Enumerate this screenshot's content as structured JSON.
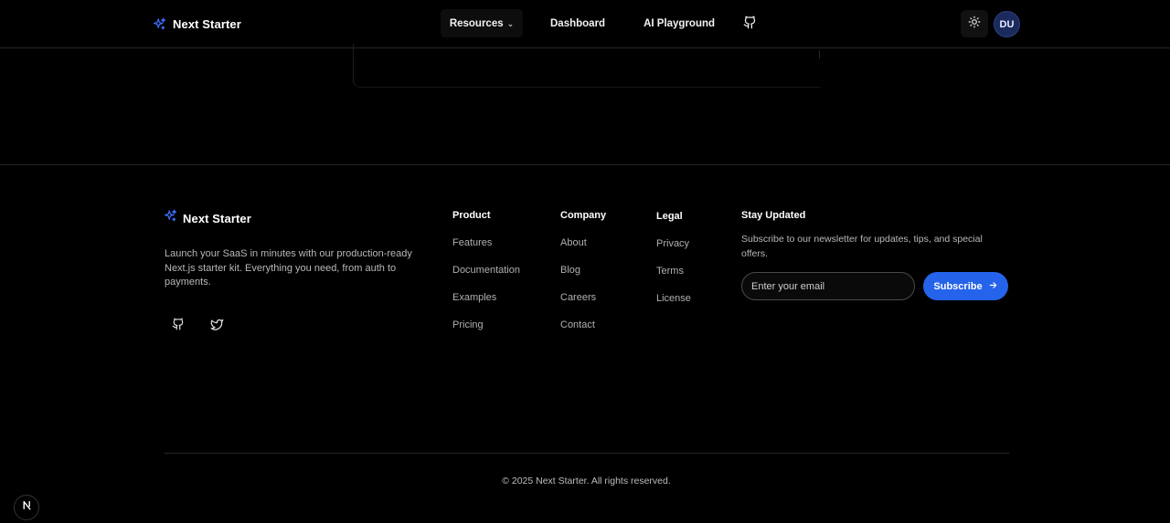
{
  "header": {
    "brand": "Next Starter",
    "nav": {
      "resources": "Resources",
      "dashboard": "Dashboard",
      "ai_playground": "AI Playground"
    },
    "avatar_initials": "DU"
  },
  "footer": {
    "brand": "Next Starter",
    "description": "Launch your SaaS in minutes with our production-ready Next.js starter kit. Everything you need, from auth to payments.",
    "columns": [
      {
        "title": "Product",
        "links": [
          "Features",
          "Documentation",
          "Examples",
          "Pricing"
        ]
      },
      {
        "title": "Company",
        "links": [
          "About",
          "Blog",
          "Careers",
          "Contact"
        ]
      },
      {
        "title": "Legal",
        "links": [
          "Privacy",
          "Terms",
          "License"
        ]
      }
    ],
    "newsletter": {
      "title": "Stay Updated",
      "description": "Subscribe to our newsletter for updates, tips, and special offers.",
      "email_placeholder": "Enter your email",
      "subscribe_label": "Subscribe"
    },
    "copyright": "© 2025 Next Starter. All rights reserved."
  },
  "colors": {
    "background": "#000000",
    "accent": "#2563eb",
    "avatar_bg": "#1b2a5c"
  },
  "icons": [
    "sparkle-icon",
    "chevron-down-icon",
    "github-icon",
    "sun-icon",
    "twitter-icon",
    "arrow-right-icon",
    "nextjs-icon"
  ]
}
